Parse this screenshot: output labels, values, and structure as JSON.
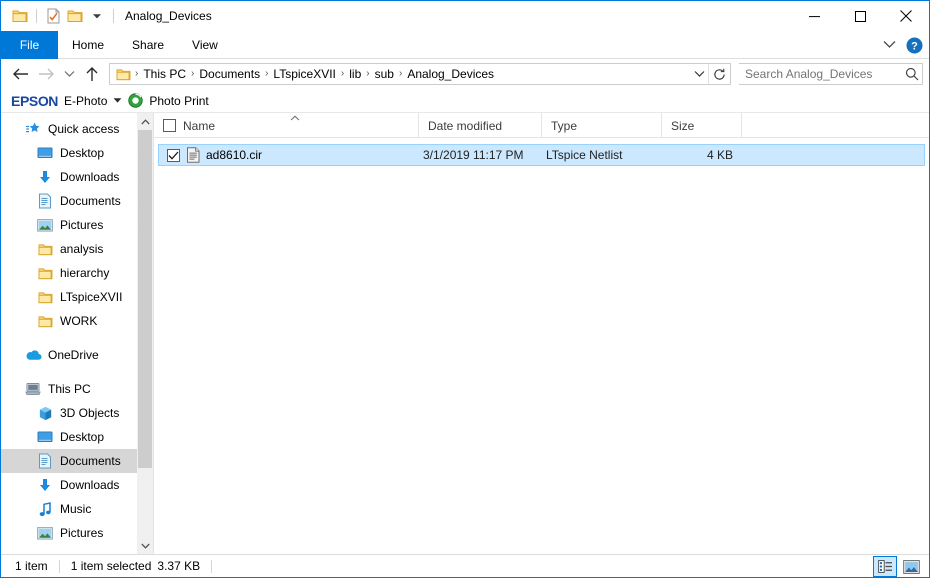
{
  "window": {
    "title": "Analog_Devices",
    "quick_access_toolbar": [
      {
        "name": "folder-icon",
        "label": "Folder"
      },
      {
        "name": "properties-icon",
        "label": "Properties"
      },
      {
        "name": "new-folder-icon",
        "label": "New folder"
      },
      {
        "name": "chevron-down-icon",
        "label": "Customize Quick Access Toolbar"
      }
    ],
    "controls": {
      "minimize": "minimize-icon",
      "maximize": "maximize-icon",
      "close": "close-icon"
    }
  },
  "ribbon": {
    "tabs": [
      {
        "label": "File",
        "active": true
      },
      {
        "label": "Home",
        "active": false
      },
      {
        "label": "Share",
        "active": false
      },
      {
        "label": "View",
        "active": false
      }
    ],
    "expand_icon": "chevron-down-icon",
    "help_icon": "help-icon",
    "help_label": "?"
  },
  "address": {
    "back_icon": "back-arrow-icon",
    "forward_icon": "forward-arrow-icon",
    "recent_icon": "chevron-down-icon",
    "up_icon": "up-arrow-icon",
    "folder_icon": "folder-icon",
    "crumbs": [
      "This PC",
      "Documents",
      "LTspiceXVII",
      "lib",
      "sub",
      "Analog_Devices"
    ],
    "separator": "›",
    "dropdown_icon": "chevron-down-icon",
    "refresh_icon": "refresh-icon"
  },
  "search": {
    "placeholder": "Search Analog_Devices",
    "value": "",
    "icon": "search-icon"
  },
  "epson_toolbar": {
    "brand": "EPSON",
    "app_label": "E-Photo",
    "dropdown_icon": "chevron-down-icon",
    "action_icon": "photo-print-icon",
    "action_label": "Photo Print",
    "brand_color": "#17479e",
    "icon_color": "#2a9d3c"
  },
  "navpane": {
    "items": [
      {
        "label": "Quick access",
        "icon": "star-icon",
        "level": 0,
        "pinned": false,
        "selected": false
      },
      {
        "label": "Desktop",
        "icon": "desktop-icon",
        "level": 1,
        "pinned": true,
        "selected": false
      },
      {
        "label": "Downloads",
        "icon": "download-icon",
        "level": 1,
        "pinned": true,
        "selected": false
      },
      {
        "label": "Documents",
        "icon": "documents-icon",
        "level": 1,
        "pinned": true,
        "selected": false
      },
      {
        "label": "Pictures",
        "icon": "pictures-icon",
        "level": 1,
        "pinned": true,
        "selected": false
      },
      {
        "label": "analysis",
        "icon": "folder-icon",
        "level": 1,
        "pinned": false,
        "selected": false
      },
      {
        "label": "hierarchy",
        "icon": "folder-icon",
        "level": 1,
        "pinned": false,
        "selected": false
      },
      {
        "label": "LTspiceXVII",
        "icon": "folder-icon",
        "level": 1,
        "pinned": false,
        "selected": false
      },
      {
        "label": "WORK",
        "icon": "folder-icon",
        "level": 1,
        "pinned": false,
        "selected": false
      },
      {
        "label": "__GAP__",
        "icon": "",
        "level": 0,
        "pinned": false,
        "selected": false
      },
      {
        "label": "OneDrive",
        "icon": "onedrive-icon",
        "level": 0,
        "pinned": false,
        "selected": false
      },
      {
        "label": "__GAP__",
        "icon": "",
        "level": 0,
        "pinned": false,
        "selected": false
      },
      {
        "label": "This PC",
        "icon": "thispc-icon",
        "level": 0,
        "pinned": false,
        "selected": false
      },
      {
        "label": "3D Objects",
        "icon": "3dobjects-icon",
        "level": 1,
        "pinned": false,
        "selected": false
      },
      {
        "label": "Desktop",
        "icon": "desktop-icon",
        "level": 1,
        "pinned": false,
        "selected": false
      },
      {
        "label": "Documents",
        "icon": "documents-icon",
        "level": 1,
        "pinned": false,
        "selected": true
      },
      {
        "label": "Downloads",
        "icon": "download-icon",
        "level": 1,
        "pinned": false,
        "selected": false
      },
      {
        "label": "Music",
        "icon": "music-icon",
        "level": 1,
        "pinned": false,
        "selected": false
      },
      {
        "label": "Pictures",
        "icon": "pictures-icon",
        "level": 1,
        "pinned": false,
        "selected": false
      }
    ],
    "scrollbar": {
      "up_icon": "chevron-up-icon",
      "down_icon": "chevron-down-icon"
    }
  },
  "filelist": {
    "columns": [
      {
        "key": "name",
        "label": "Name",
        "sorted": "asc"
      },
      {
        "key": "date",
        "label": "Date modified",
        "sorted": ""
      },
      {
        "key": "type",
        "label": "Type",
        "sorted": ""
      },
      {
        "key": "size",
        "label": "Size",
        "sorted": ""
      }
    ],
    "sort_icon": "chevron-up-icon",
    "header_checkbox_checked": false,
    "rows": [
      {
        "checked": true,
        "icon": "netlist-file-icon",
        "name": "ad8610.cir",
        "date": "3/1/2019 11:17 PM",
        "type": "LTspice Netlist",
        "size": "4 KB",
        "selected": true
      }
    ]
  },
  "statusbar": {
    "item_count": "1 item",
    "selection": "1 item selected",
    "selection_size": "3.37 KB",
    "views": [
      {
        "name": "details-view-button",
        "icon": "details-view-icon",
        "active": true
      },
      {
        "name": "large-icons-view-button",
        "icon": "large-icons-view-icon",
        "active": false
      }
    ]
  },
  "colors": {
    "accent": "#0078d7",
    "selection": "#cce8ff",
    "folder": "#ffd970"
  }
}
